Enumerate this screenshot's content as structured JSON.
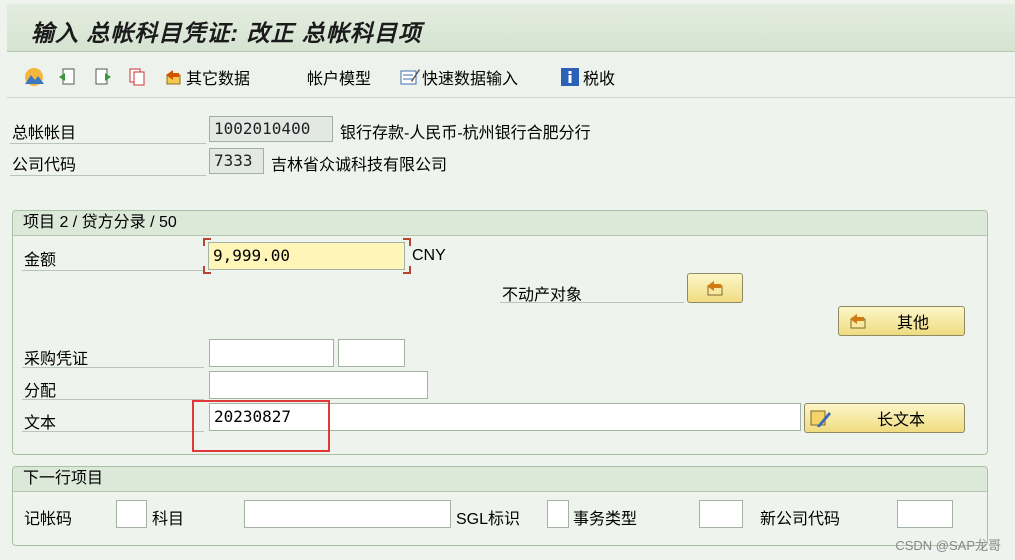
{
  "title": "输入 总帐科目凭证: 改正 总帐科目项",
  "toolbar": {
    "other_data": "其它数据",
    "account_model": "帐户模型",
    "fast_entry": "快速数据输入",
    "tax": "税收"
  },
  "header": {
    "gl_account_label": "总帐帐目",
    "gl_account_value": "1002010400",
    "gl_account_desc": "银行存款-人民币-杭州银行合肥分行",
    "company_code_label": "公司代码",
    "company_code_value": "7333",
    "company_code_desc": "吉林省众诚科技有限公司"
  },
  "item_group": {
    "title": "项目 2 / 贷方分录 / 50",
    "amount_label": "金额",
    "amount_value": "9,999.00",
    "currency": "CNY",
    "real_estate_label": "不动产对象",
    "other_button": "其他",
    "po_label": "采购凭证",
    "po_value": "",
    "po_item_value": "",
    "assignment_label": "分配",
    "assignment_value": "",
    "text_label": "文本",
    "text_value": "20230827",
    "long_text_button": "长文本"
  },
  "next_item": {
    "title": "下一行项目",
    "posting_key_label": "记帐码",
    "posting_key_value": "",
    "account_label": "科目",
    "account_value": "",
    "sgl_label": "SGL标识",
    "sgl_value": "",
    "trans_type_label": "事务类型",
    "trans_type_value": "",
    "new_company_label": "新公司代码",
    "new_company_value": ""
  },
  "watermark": "CSDN @SAP龙哥"
}
